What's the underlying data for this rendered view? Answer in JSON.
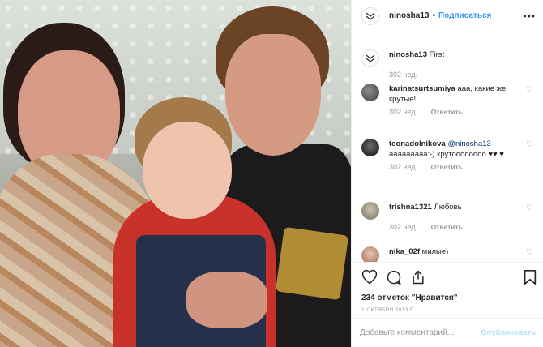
{
  "post": {
    "username": "ninosha13",
    "follow_label": "Подписаться",
    "separator": "•",
    "more_glyph": "•••",
    "caption_user": "ninosha13",
    "caption_text": "First",
    "caption_time": "302 нед."
  },
  "comments": [
    {
      "user": "karinatsurtsumiya",
      "text": "ааа, какие же крутые!",
      "time": "302 нед.",
      "reply": "Ответить"
    },
    {
      "user": "teonadolnikova",
      "mention": "@ninosha13",
      "text": "ааааааааа:-) крутоооооооо ♥♥ ♥",
      "time": "302 нед.",
      "reply": "Ответить"
    },
    {
      "user": "trishna1321",
      "text": "Любовь",
      "time": "302 нед.",
      "reply": "Ответить"
    },
    {
      "user": "nika_02f",
      "text": "милые)",
      "time": "",
      "reply": ""
    }
  ],
  "footer": {
    "likes": "234 отметок \"Нравится\"",
    "date": "1 ОКТЯБРЯ 2013 Г.",
    "comment_placeholder": "Добавьте комментарий...",
    "publish_label": "Опубликовать"
  },
  "icons": {
    "avatar": "ninosha13-logo-icon",
    "like": "heart-icon",
    "comment": "comment-icon",
    "share": "share-icon",
    "save": "bookmark-icon"
  },
  "colors": {
    "link": "#3897f0",
    "muted": "#999999",
    "publish_disabled": "#b2dffc"
  }
}
